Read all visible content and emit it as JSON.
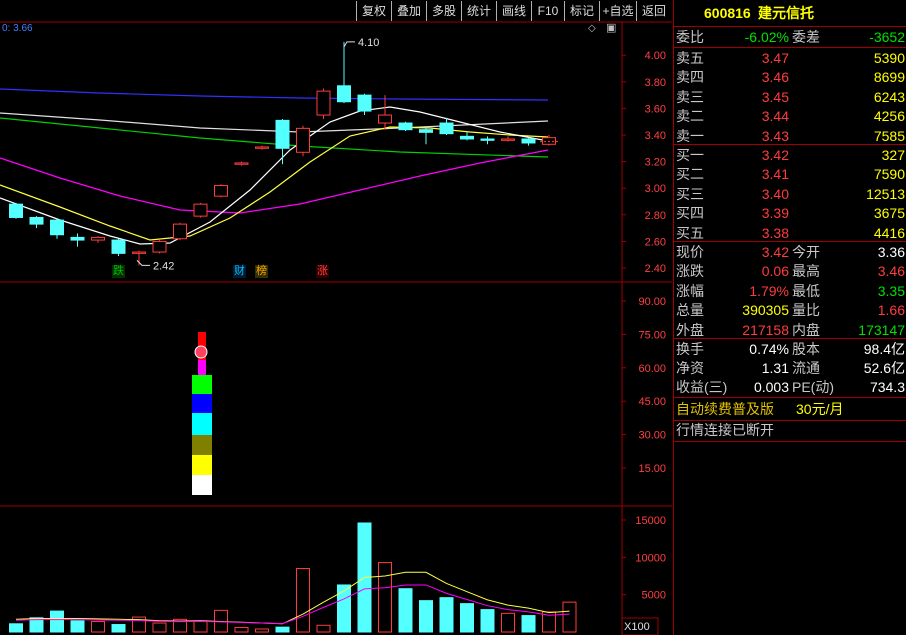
{
  "toolbar": {
    "buttons": [
      "复权",
      "叠加",
      "多股",
      "统计",
      "画线",
      "F10",
      "标记",
      "+自选",
      "返回"
    ]
  },
  "chart": {
    "ma_readout": "0: 3.66",
    "price_axis": [
      "4.00",
      "3.80",
      "3.60",
      "3.40",
      "3.20",
      "3.00",
      "2.80",
      "2.60",
      "2.40"
    ],
    "high_label": "4.10",
    "low_label": "2.42",
    "events": [
      {
        "text": "跌",
        "color": "#00c000",
        "bg": "#003000"
      },
      {
        "text": "财",
        "color": "#00c0ff",
        "bg": "#001a30"
      },
      {
        "text": "榜",
        "color": "#ffa000",
        "bg": "#303000"
      },
      {
        "text": "涨",
        "color": "#ff4040",
        "bg": "#300000"
      }
    ],
    "indicator_axis": [
      "90.00",
      "75.00",
      "60.00",
      "45.00",
      "30.00",
      "15.00"
    ],
    "volume_axis": [
      "15000",
      "10000",
      "5000"
    ],
    "volume_unit": "X100",
    "candles": [
      {
        "o": 2.88,
        "c": 2.78,
        "h": 2.89,
        "l": 2.77
      },
      {
        "o": 2.78,
        "c": 2.73,
        "h": 2.79,
        "l": 2.7
      },
      {
        "o": 2.76,
        "c": 2.65,
        "h": 2.77,
        "l": 2.62
      },
      {
        "o": 2.63,
        "c": 2.61,
        "h": 2.66,
        "l": 2.56
      },
      {
        "o": 2.61,
        "c": 2.63,
        "h": 2.64,
        "l": 2.59
      },
      {
        "o": 2.61,
        "c": 2.51,
        "h": 2.62,
        "l": 2.49
      },
      {
        "o": 2.51,
        "c": 2.52,
        "h": 2.53,
        "l": 2.42
      },
      {
        "o": 2.52,
        "c": 2.6,
        "h": 2.61,
        "l": 2.51
      },
      {
        "o": 2.62,
        "c": 2.73,
        "h": 2.74,
        "l": 2.61
      },
      {
        "o": 2.79,
        "c": 2.88,
        "h": 2.89,
        "l": 2.78
      },
      {
        "o": 2.94,
        "c": 3.02,
        "h": 3.03,
        "l": 2.93
      },
      {
        "o": 3.18,
        "c": 3.19,
        "h": 3.2,
        "l": 3.17
      },
      {
        "o": 3.3,
        "c": 3.31,
        "h": 3.32,
        "l": 3.29
      },
      {
        "o": 3.51,
        "c": 3.3,
        "h": 3.52,
        "l": 3.18
      },
      {
        "o": 3.27,
        "c": 3.45,
        "h": 3.47,
        "l": 3.24
      },
      {
        "o": 3.55,
        "c": 3.73,
        "h": 3.75,
        "l": 3.52
      },
      {
        "o": 3.77,
        "c": 3.65,
        "h": 4.1,
        "l": 3.64
      },
      {
        "o": 3.7,
        "c": 3.58,
        "h": 3.71,
        "l": 3.55
      },
      {
        "o": 3.49,
        "c": 3.55,
        "h": 3.7,
        "l": 3.44
      },
      {
        "o": 3.49,
        "c": 3.44,
        "h": 3.5,
        "l": 3.43
      },
      {
        "o": 3.44,
        "c": 3.42,
        "h": 3.45,
        "l": 3.33
      },
      {
        "o": 3.49,
        "c": 3.41,
        "h": 3.53,
        "l": 3.4
      },
      {
        "o": 3.39,
        "c": 3.37,
        "h": 3.42,
        "l": 3.36
      },
      {
        "o": 3.37,
        "c": 3.36,
        "h": 3.39,
        "l": 3.33
      },
      {
        "o": 3.36,
        "c": 3.37,
        "h": 3.39,
        "l": 3.35
      },
      {
        "o": 3.37,
        "c": 3.34,
        "h": 3.38,
        "l": 3.32
      },
      {
        "o": 3.33,
        "c": 3.38,
        "h": 3.4,
        "l": 3.32
      }
    ],
    "volumes": [
      1100,
      1900,
      2800,
      1500,
      1400,
      1000,
      2000,
      1200,
      1700,
      1400,
      2900,
      600,
      400,
      650,
      8500,
      900,
      6300,
      14600,
      9300,
      5800,
      4200,
      4600,
      3800,
      3000,
      2500,
      2200,
      2700,
      4000
    ],
    "vol_ma": [
      1700,
      1800,
      1800,
      1800,
      1750,
      1700,
      1650,
      1500,
      1450,
      1500,
      1400,
      1300,
      1200,
      1100,
      2400,
      4000,
      5500,
      7300,
      7500,
      8000,
      8000,
      6500,
      5400,
      4300,
      3600,
      3200,
      2600,
      2800
    ],
    "bar_colors": [
      "#ffffff",
      "#ffff00",
      "#808000",
      "#00ffff",
      "#0000ff",
      "#00ff00",
      "#ff00ff",
      "#ff0000"
    ]
  },
  "panel": {
    "code": "600816",
    "name": "建元信托",
    "weibi_label": "委比",
    "weibi_value": "-6.02%",
    "weicha_label": "委差",
    "weicha_value": "-3652",
    "sells": [
      {
        "label": "卖五",
        "price": "3.47",
        "vol": "5390"
      },
      {
        "label": "卖四",
        "price": "3.46",
        "vol": "8699"
      },
      {
        "label": "卖三",
        "price": "3.45",
        "vol": "6243"
      },
      {
        "label": "卖二",
        "price": "3.44",
        "vol": "4256"
      },
      {
        "label": "卖一",
        "price": "3.43",
        "vol": "7585"
      }
    ],
    "buys": [
      {
        "label": "买一",
        "price": "3.42",
        "vol": "327"
      },
      {
        "label": "买二",
        "price": "3.41",
        "vol": "7590"
      },
      {
        "label": "买三",
        "price": "3.40",
        "vol": "12513"
      },
      {
        "label": "买四",
        "price": "3.39",
        "vol": "3675"
      },
      {
        "label": "买五",
        "price": "3.38",
        "vol": "4416"
      }
    ],
    "stats": [
      {
        "l1": "现价",
        "v1": "3.42",
        "c1": "red",
        "l2": "今开",
        "v2": "3.36",
        "c2": "white"
      },
      {
        "l1": "涨跌",
        "v1": "0.06",
        "c1": "red",
        "l2": "最高",
        "v2": "3.46",
        "c2": "red"
      },
      {
        "l1": "涨幅",
        "v1": "1.79%",
        "c1": "red",
        "l2": "最低",
        "v2": "3.35",
        "c2": "green"
      },
      {
        "l1": "总量",
        "v1": "390305",
        "c1": "yellow",
        "l2": "量比",
        "v2": "1.66",
        "c2": "red"
      },
      {
        "l1": "外盘",
        "v1": "217158",
        "c1": "red",
        "l2": "内盘",
        "v2": "173147",
        "c2": "green"
      }
    ],
    "stats2": [
      {
        "l1": "换手",
        "v1": "0.74%",
        "l2": "股本",
        "v2": "98.4亿"
      },
      {
        "l1": "净资",
        "v1": "1.31",
        "l2": "流通",
        "v2": "52.6亿"
      },
      {
        "l1": "收益(三)",
        "v1": "0.003",
        "l2": "PE(动)",
        "v2": "734.3"
      }
    ],
    "promo_text": "自动续费普及版",
    "promo_price": "30元/月",
    "status": "行情连接已断开"
  }
}
